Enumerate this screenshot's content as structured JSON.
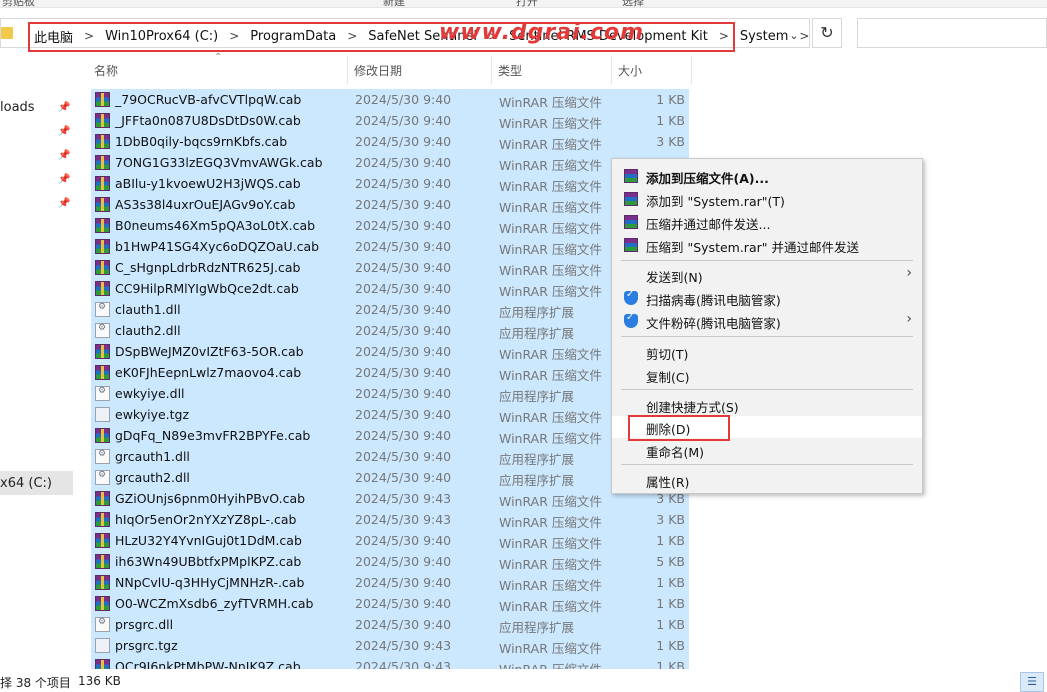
{
  "toolbar_top": {
    "labels": [
      "剪贴板",
      "新建",
      "打开",
      "选择"
    ]
  },
  "address": {
    "crumbs": [
      "此电脑",
      "Win10Prox64 (C:)",
      "ProgramData",
      "SafeNet Sentinel",
      "Sentinel RMS Development Kit",
      "System"
    ],
    "separator": ">",
    "dropdown_icon": "chevron-down-icon",
    "refresh_icon": "refresh-icon"
  },
  "watermark": "www.dgrai.com",
  "nav": {
    "downloads_label": "loads",
    "drive_label": "x64 (C:)"
  },
  "columns": {
    "name": "名称",
    "date": "修改日期",
    "type": "类型",
    "size": "大小"
  },
  "files": [
    {
      "name": "_79OCRucVB-afvCVTlpqW.cab",
      "date": "2024/5/30 9:40",
      "type": "WinRAR 压缩文件",
      "size": "1 KB",
      "icon": "rar"
    },
    {
      "name": "_JFFta0n087U8DsDtDs0W.cab",
      "date": "2024/5/30 9:40",
      "type": "WinRAR 压缩文件",
      "size": "1 KB",
      "icon": "rar"
    },
    {
      "name": "1DbB0qily-bqcs9rnKbfs.cab",
      "date": "2024/5/30 9:40",
      "type": "WinRAR 压缩文件",
      "size": "3 KB",
      "icon": "rar"
    },
    {
      "name": "7ONG1G33lzEGQ3VmvAWGk.cab",
      "date": "2024/5/30 9:40",
      "type": "WinRAR 压缩文件",
      "size": "",
      "icon": "rar"
    },
    {
      "name": "aBIlu-y1kvoewU2H3jWQS.cab",
      "date": "2024/5/30 9:40",
      "type": "WinRAR 压缩文件",
      "size": "",
      "icon": "rar"
    },
    {
      "name": "AS3s38l4uxrOuEJAGv9oY.cab",
      "date": "2024/5/30 9:40",
      "type": "WinRAR 压缩文件",
      "size": "",
      "icon": "rar"
    },
    {
      "name": "B0neums46Xm5pQA3oL0tX.cab",
      "date": "2024/5/30 9:40",
      "type": "WinRAR 压缩文件",
      "size": "",
      "icon": "rar"
    },
    {
      "name": "b1HwP41SG4Xyc6oDQZOaU.cab",
      "date": "2024/5/30 9:40",
      "type": "WinRAR 压缩文件",
      "size": "",
      "icon": "rar"
    },
    {
      "name": "C_sHgnpLdrbRdzNTR625J.cab",
      "date": "2024/5/30 9:40",
      "type": "WinRAR 压缩文件",
      "size": "",
      "icon": "rar"
    },
    {
      "name": "CC9HilpRMlYIgWbQce2dt.cab",
      "date": "2024/5/30 9:40",
      "type": "WinRAR 压缩文件",
      "size": "",
      "icon": "rar"
    },
    {
      "name": "clauth1.dll",
      "date": "2024/5/30 9:40",
      "type": "应用程序扩展",
      "size": "",
      "icon": "dll"
    },
    {
      "name": "clauth2.dll",
      "date": "2024/5/30 9:40",
      "type": "应用程序扩展",
      "size": "",
      "icon": "dll"
    },
    {
      "name": "DSpBWeJMZ0vIZtF63-5OR.cab",
      "date": "2024/5/30 9:40",
      "type": "WinRAR 压缩文件",
      "size": "",
      "icon": "rar"
    },
    {
      "name": "eK0FJhEepnLwlz7maovo4.cab",
      "date": "2024/5/30 9:40",
      "type": "WinRAR 压缩文件",
      "size": "",
      "icon": "rar"
    },
    {
      "name": "ewkyiye.dll",
      "date": "2024/5/30 9:40",
      "type": "应用程序扩展",
      "size": "",
      "icon": "dll"
    },
    {
      "name": "ewkyiye.tgz",
      "date": "2024/5/30 9:40",
      "type": "WinRAR 压缩文件",
      "size": "",
      "icon": "tgz"
    },
    {
      "name": "gDqFq_N89e3mvFR2BPYFe.cab",
      "date": "2024/5/30 9:40",
      "type": "WinRAR 压缩文件",
      "size": "",
      "icon": "rar"
    },
    {
      "name": "grcauth1.dll",
      "date": "2024/5/30 9:40",
      "type": "应用程序扩展",
      "size": "",
      "icon": "dll"
    },
    {
      "name": "grcauth2.dll",
      "date": "2024/5/30 9:40",
      "type": "应用程序扩展",
      "size": "",
      "icon": "dll"
    },
    {
      "name": "GZiOUnjs6pnm0HyihPBvO.cab",
      "date": "2024/5/30 9:43",
      "type": "WinRAR 压缩文件",
      "size": "3 KB",
      "icon": "rar"
    },
    {
      "name": "hIqOr5enOr2nYXzYZ8pL-.cab",
      "date": "2024/5/30 9:43",
      "type": "WinRAR 压缩文件",
      "size": "3 KB",
      "icon": "rar"
    },
    {
      "name": "HLzU32Y4YvnIGuj0t1DdM.cab",
      "date": "2024/5/30 9:40",
      "type": "WinRAR 压缩文件",
      "size": "1 KB",
      "icon": "rar"
    },
    {
      "name": "ih63Wn49UBbtfxPMplKPZ.cab",
      "date": "2024/5/30 9:40",
      "type": "WinRAR 压缩文件",
      "size": "5 KB",
      "icon": "rar"
    },
    {
      "name": "NNpCvlU-q3HHyCjMNHzR-.cab",
      "date": "2024/5/30 9:40",
      "type": "WinRAR 压缩文件",
      "size": "1 KB",
      "icon": "rar"
    },
    {
      "name": "O0-WCZmXsdb6_zyfTVRMH.cab",
      "date": "2024/5/30 9:40",
      "type": "WinRAR 压缩文件",
      "size": "1 KB",
      "icon": "rar"
    },
    {
      "name": "prsgrc.dll",
      "date": "2024/5/30 9:40",
      "type": "应用程序扩展",
      "size": "1 KB",
      "icon": "dll"
    },
    {
      "name": "prsgrc.tgz",
      "date": "2024/5/30 9:43",
      "type": "WinRAR 压缩文件",
      "size": "1 KB",
      "icon": "tgz"
    },
    {
      "name": "OCr9I6nkPtMbPW-NnJK9Z.cab",
      "date": "2024/5/30 9:43",
      "type": "WinRAR 压缩文件",
      "size": "1 KB",
      "icon": "rar"
    }
  ],
  "context_menu": {
    "add_archive": "添加到压缩文件(A)...",
    "add_to_rar": "添加到 \"System.rar\"(T)",
    "compress_email": "压缩并通过邮件发送...",
    "compress_to_rar_email": "压缩到 \"System.rar\" 并通过邮件发送",
    "send_to": "发送到(N)",
    "scan_virus": "扫描病毒(腾讯电脑管家)",
    "shred": "文件粉碎(腾讯电脑管家)",
    "cut": "剪切(T)",
    "copy": "复制(C)",
    "create_shortcut": "创建快捷方式(S)",
    "delete": "删除(D)",
    "rename": "重命名(M)",
    "properties": "属性(R)"
  },
  "status": {
    "items_selected": "择 38 个项目",
    "size": "136 KB"
  },
  "colors": {
    "selection": "#cce8ff",
    "highlight_box": "#e23a3a"
  }
}
